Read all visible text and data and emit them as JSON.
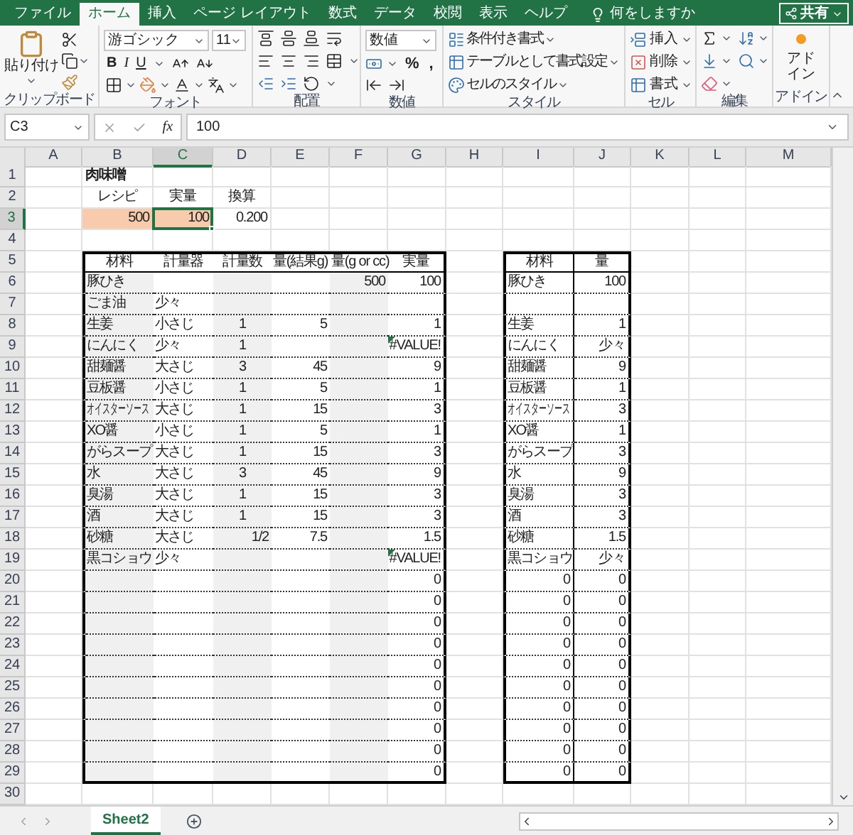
{
  "ribbon_tabs": [
    {
      "label": "ファイル",
      "selected": false
    },
    {
      "label": "ホーム",
      "selected": true
    },
    {
      "label": "挿入",
      "selected": false
    },
    {
      "label": "ページ レイアウト",
      "selected": false
    },
    {
      "label": "数式",
      "selected": false
    },
    {
      "label": "データ",
      "selected": false
    },
    {
      "label": "校閲",
      "selected": false
    },
    {
      "label": "表示",
      "selected": false
    },
    {
      "label": "ヘルプ",
      "selected": false
    }
  ],
  "tell_me": "何をしますか",
  "share": "共有",
  "ribbon_groups": [
    {
      "kind": "clipboard",
      "label": "クリップボード",
      "paste": "貼り付け"
    },
    {
      "kind": "font",
      "label": "フォント",
      "font": "游ゴシック",
      "size": "11",
      "styles": [
        "B",
        "I",
        "U"
      ]
    },
    {
      "kind": "alignment",
      "label": "配置"
    },
    {
      "kind": "number",
      "label": "数値",
      "format": "数値",
      "symbols": [
        "%",
        ","
      ]
    },
    {
      "kind": "styles",
      "label": "スタイル",
      "commands": [
        "条件付き書式",
        "テーブルとして書式設定",
        "セルのスタイル"
      ]
    },
    {
      "kind": "cells",
      "label": "セル",
      "commands": [
        "挿入",
        "削除",
        "書式"
      ]
    },
    {
      "kind": "editing",
      "label": "編集"
    },
    {
      "kind": "addins",
      "label": "アドイン",
      "button": "アドイン"
    }
  ],
  "formula_bar": {
    "name_box": "C3",
    "function_label": "fx",
    "formula": "100"
  },
  "columns": [
    {
      "label": "A",
      "selected": false
    },
    {
      "label": "B",
      "selected": false
    },
    {
      "label": "C",
      "selected": true
    },
    {
      "label": "D",
      "selected": false
    },
    {
      "label": "E",
      "selected": false
    },
    {
      "label": "F",
      "selected": false
    },
    {
      "label": "G",
      "selected": false
    },
    {
      "label": "H",
      "selected": false
    },
    {
      "label": "I",
      "selected": false
    },
    {
      "label": "J",
      "selected": false
    },
    {
      "label": "K",
      "selected": false
    },
    {
      "label": "L",
      "selected": false
    },
    {
      "label": "M",
      "selected": false
    }
  ],
  "rows": [
    {
      "number": "1",
      "selected": false,
      "cells": {
        "B": {
          "text": "肉味噌",
          "kind": "title",
          "selected": false
        }
      }
    },
    {
      "number": "2",
      "selected": false,
      "cells": {
        "B": {
          "text": "レシピ",
          "kind": "center",
          "selected": false
        },
        "C": {
          "text": "実量",
          "kind": "center",
          "selected": false
        },
        "D": {
          "text": "換算",
          "kind": "center",
          "selected": false
        }
      }
    },
    {
      "number": "3",
      "selected": true,
      "cells": {
        "B": {
          "text": "500",
          "kind": "num",
          "selected": false,
          "color": "#f8cbad"
        },
        "C": {
          "text": "100",
          "kind": "num",
          "selected": true,
          "color": "#f8cbad"
        },
        "D": {
          "text": "0.200",
          "kind": "num",
          "selected": false
        }
      }
    },
    {
      "number": "4",
      "selected": false,
      "cells": {}
    },
    {
      "number": "5",
      "selected": false,
      "cells": {
        "B": {
          "text": "材料",
          "kind": "head",
          "selected": false
        },
        "C": {
          "text": "計量器",
          "kind": "head",
          "selected": false
        },
        "D": {
          "text": "計量数",
          "kind": "head",
          "selected": false
        },
        "E": {
          "text": "量(結果g)",
          "kind": "headleft",
          "selected": false
        },
        "F": {
          "text": "量(g or cc)",
          "kind": "headleft",
          "selected": false
        },
        "G": {
          "text": "実量",
          "kind": "head",
          "selected": false
        },
        "I": {
          "text": "材料",
          "kind": "head",
          "selected": false
        },
        "J": {
          "text": "量",
          "kind": "head",
          "selected": false
        }
      }
    },
    {
      "number": "6",
      "selected": false,
      "cells": {
        "B": {
          "text": "豚ひき",
          "kind": "text",
          "selected": false
        },
        "F": {
          "text": "500",
          "kind": "num",
          "selected": false
        },
        "G": {
          "text": "100",
          "kind": "num",
          "selected": false
        },
        "I": {
          "text": "豚ひき",
          "kind": "text",
          "selected": false
        },
        "J": {
          "text": "100",
          "kind": "num",
          "selected": false
        }
      }
    },
    {
      "number": "7",
      "selected": false,
      "cells": {
        "B": {
          "text": "ごま油",
          "kind": "text",
          "selected": false
        },
        "C": {
          "text": "少々",
          "kind": "text",
          "selected": false
        }
      }
    },
    {
      "number": "8",
      "selected": false,
      "cells": {
        "B": {
          "text": "生姜",
          "kind": "text",
          "selected": false
        },
        "C": {
          "text": "小さじ",
          "kind": "text",
          "selected": false
        },
        "D": {
          "text": "1",
          "kind": "center",
          "selected": false
        },
        "E": {
          "text": "5",
          "kind": "num",
          "selected": false
        },
        "G": {
          "text": "1",
          "kind": "num",
          "selected": false
        },
        "I": {
          "text": "生姜",
          "kind": "text",
          "selected": false
        },
        "J": {
          "text": "1",
          "kind": "num",
          "selected": false
        }
      }
    },
    {
      "number": "9",
      "selected": false,
      "cells": {
        "B": {
          "text": "にんにく",
          "kind": "text",
          "selected": false
        },
        "C": {
          "text": "少々",
          "kind": "text",
          "selected": false
        },
        "D": {
          "text": "1",
          "kind": "center",
          "selected": false
        },
        "G": {
          "text": "#VALUE!",
          "kind": "error",
          "selected": false
        },
        "I": {
          "text": "にんにく",
          "kind": "text",
          "selected": false
        },
        "J": {
          "text": "少々",
          "kind": "num",
          "selected": false
        }
      }
    },
    {
      "number": "10",
      "selected": false,
      "cells": {
        "B": {
          "text": "甜麺醤",
          "kind": "text",
          "selected": false
        },
        "C": {
          "text": "大さじ",
          "kind": "text",
          "selected": false
        },
        "D": {
          "text": "3",
          "kind": "center",
          "selected": false
        },
        "E": {
          "text": "45",
          "kind": "num",
          "selected": false
        },
        "G": {
          "text": "9",
          "kind": "num",
          "selected": false
        },
        "I": {
          "text": "甜麺醤",
          "kind": "text",
          "selected": false
        },
        "J": {
          "text": "9",
          "kind": "num",
          "selected": false
        }
      }
    },
    {
      "number": "11",
      "selected": false,
      "cells": {
        "B": {
          "text": "豆板醤",
          "kind": "text",
          "selected": false
        },
        "C": {
          "text": "小さじ",
          "kind": "text",
          "selected": false
        },
        "D": {
          "text": "1",
          "kind": "center",
          "selected": false
        },
        "E": {
          "text": "5",
          "kind": "num",
          "selected": false
        },
        "G": {
          "text": "1",
          "kind": "num",
          "selected": false
        },
        "I": {
          "text": "豆板醤",
          "kind": "text",
          "selected": false
        },
        "J": {
          "text": "1",
          "kind": "num",
          "selected": false
        }
      }
    },
    {
      "number": "12",
      "selected": false,
      "cells": {
        "B": {
          "text": "オイスターソース",
          "kind": "tiny",
          "selected": false
        },
        "C": {
          "text": "大さじ",
          "kind": "text",
          "selected": false
        },
        "D": {
          "text": "1",
          "kind": "center",
          "selected": false
        },
        "E": {
          "text": "15",
          "kind": "num",
          "selected": false
        },
        "G": {
          "text": "3",
          "kind": "num",
          "selected": false
        },
        "I": {
          "text": "オイスターソース",
          "kind": "tiny",
          "selected": false
        },
        "J": {
          "text": "3",
          "kind": "num",
          "selected": false
        }
      }
    },
    {
      "number": "13",
      "selected": false,
      "cells": {
        "B": {
          "text": "XO醤",
          "kind": "text",
          "selected": false
        },
        "C": {
          "text": "小さじ",
          "kind": "text",
          "selected": false
        },
        "D": {
          "text": "1",
          "kind": "center",
          "selected": false
        },
        "E": {
          "text": "5",
          "kind": "num",
          "selected": false
        },
        "G": {
          "text": "1",
          "kind": "num",
          "selected": false
        },
        "I": {
          "text": "XO醤",
          "kind": "text",
          "selected": false
        },
        "J": {
          "text": "1",
          "kind": "num",
          "selected": false
        }
      }
    },
    {
      "number": "14",
      "selected": false,
      "cells": {
        "B": {
          "text": "がらスープ",
          "kind": "text",
          "selected": false
        },
        "C": {
          "text": "大さじ",
          "kind": "text",
          "selected": false
        },
        "D": {
          "text": "1",
          "kind": "center",
          "selected": false
        },
        "E": {
          "text": "15",
          "kind": "num",
          "selected": false
        },
        "G": {
          "text": "3",
          "kind": "num",
          "selected": false
        },
        "I": {
          "text": "がらスープ",
          "kind": "text",
          "selected": false
        },
        "J": {
          "text": "3",
          "kind": "num",
          "selected": false
        }
      }
    },
    {
      "number": "15",
      "selected": false,
      "cells": {
        "B": {
          "text": "水",
          "kind": "text",
          "selected": false
        },
        "C": {
          "text": "大さじ",
          "kind": "text",
          "selected": false
        },
        "D": {
          "text": "3",
          "kind": "center",
          "selected": false
        },
        "E": {
          "text": "45",
          "kind": "num",
          "selected": false
        },
        "G": {
          "text": "9",
          "kind": "num",
          "selected": false
        },
        "I": {
          "text": "水",
          "kind": "text",
          "selected": false
        },
        "J": {
          "text": "9",
          "kind": "num",
          "selected": false
        }
      }
    },
    {
      "number": "16",
      "selected": false,
      "cells": {
        "B": {
          "text": "臭湯",
          "kind": "text",
          "selected": false
        },
        "C": {
          "text": "大さじ",
          "kind": "text",
          "selected": false
        },
        "D": {
          "text": "1",
          "kind": "center",
          "selected": false
        },
        "E": {
          "text": "15",
          "kind": "num",
          "selected": false
        },
        "G": {
          "text": "3",
          "kind": "num",
          "selected": false
        },
        "I": {
          "text": "臭湯",
          "kind": "text",
          "selected": false
        },
        "J": {
          "text": "3",
          "kind": "num",
          "selected": false
        }
      }
    },
    {
      "number": "17",
      "selected": false,
      "cells": {
        "B": {
          "text": "酒",
          "kind": "text",
          "selected": false
        },
        "C": {
          "text": "大さじ",
          "kind": "text",
          "selected": false
        },
        "D": {
          "text": "1",
          "kind": "center",
          "selected": false
        },
        "E": {
          "text": "15",
          "kind": "num",
          "selected": false
        },
        "G": {
          "text": "3",
          "kind": "num",
          "selected": false
        },
        "I": {
          "text": "酒",
          "kind": "text",
          "selected": false
        },
        "J": {
          "text": "3",
          "kind": "num",
          "selected": false
        }
      }
    },
    {
      "number": "18",
      "selected": false,
      "cells": {
        "B": {
          "text": "砂糖",
          "kind": "text",
          "selected": false
        },
        "C": {
          "text": "大さじ",
          "kind": "text",
          "selected": false
        },
        "D": {
          "text": "1/2",
          "kind": "num",
          "selected": false
        },
        "E": {
          "text": "7.5",
          "kind": "num",
          "selected": false
        },
        "G": {
          "text": "1.5",
          "kind": "num",
          "selected": false
        },
        "I": {
          "text": "砂糖",
          "kind": "text",
          "selected": false
        },
        "J": {
          "text": "1.5",
          "kind": "num",
          "selected": false
        }
      }
    },
    {
      "number": "19",
      "selected": false,
      "cells": {
        "B": {
          "text": "黒コショウ",
          "kind": "text",
          "selected": false
        },
        "C": {
          "text": "少々",
          "kind": "text",
          "selected": false
        },
        "G": {
          "text": "#VALUE!",
          "kind": "error",
          "selected": false
        },
        "I": {
          "text": "黒コショウ",
          "kind": "text",
          "selected": false
        },
        "J": {
          "text": "少々",
          "kind": "num",
          "selected": false
        }
      }
    },
    {
      "number": "20",
      "selected": false,
      "cells": {
        "G": {
          "text": "0",
          "kind": "num",
          "selected": false
        },
        "I": {
          "text": "0",
          "kind": "num",
          "selected": false
        },
        "J": {
          "text": "0",
          "kind": "num",
          "selected": false
        }
      }
    },
    {
      "number": "21",
      "selected": false,
      "cells": {
        "G": {
          "text": "0",
          "kind": "num",
          "selected": false
        },
        "I": {
          "text": "0",
          "kind": "num",
          "selected": false
        },
        "J": {
          "text": "0",
          "kind": "num",
          "selected": false
        }
      }
    },
    {
      "number": "22",
      "selected": false,
      "cells": {
        "G": {
          "text": "0",
          "kind": "num",
          "selected": false
        },
        "I": {
          "text": "0",
          "kind": "num",
          "selected": false
        },
        "J": {
          "text": "0",
          "kind": "num",
          "selected": false
        }
      }
    },
    {
      "number": "23",
      "selected": false,
      "cells": {
        "G": {
          "text": "0",
          "kind": "num",
          "selected": false
        },
        "I": {
          "text": "0",
          "kind": "num",
          "selected": false
        },
        "J": {
          "text": "0",
          "kind": "num",
          "selected": false
        }
      }
    },
    {
      "number": "24",
      "selected": false,
      "cells": {
        "G": {
          "text": "0",
          "kind": "num",
          "selected": false
        },
        "I": {
          "text": "0",
          "kind": "num",
          "selected": false
        },
        "J": {
          "text": "0",
          "kind": "num",
          "selected": false
        }
      }
    },
    {
      "number": "25",
      "selected": false,
      "cells": {
        "G": {
          "text": "0",
          "kind": "num",
          "selected": false
        },
        "I": {
          "text": "0",
          "kind": "num",
          "selected": false
        },
        "J": {
          "text": "0",
          "kind": "num",
          "selected": false
        }
      }
    },
    {
      "number": "26",
      "selected": false,
      "cells": {
        "G": {
          "text": "0",
          "kind": "num",
          "selected": false
        },
        "I": {
          "text": "0",
          "kind": "num",
          "selected": false
        },
        "J": {
          "text": "0",
          "kind": "num",
          "selected": false
        }
      }
    },
    {
      "number": "27",
      "selected": false,
      "cells": {
        "G": {
          "text": "0",
          "kind": "num",
          "selected": false
        },
        "I": {
          "text": "0",
          "kind": "num",
          "selected": false
        },
        "J": {
          "text": "0",
          "kind": "num",
          "selected": false
        }
      }
    },
    {
      "number": "28",
      "selected": false,
      "cells": {
        "G": {
          "text": "0",
          "kind": "num",
          "selected": false
        },
        "I": {
          "text": "0",
          "kind": "num",
          "selected": false
        },
        "J": {
          "text": "0",
          "kind": "num",
          "selected": false
        }
      }
    },
    {
      "number": "29",
      "selected": false,
      "cells": {
        "G": {
          "text": "0",
          "kind": "num",
          "selected": false
        },
        "I": {
          "text": "0",
          "kind": "num",
          "selected": false
        },
        "J": {
          "text": "0",
          "kind": "num",
          "selected": false
        }
      }
    },
    {
      "number": "30",
      "selected": false,
      "cells": {}
    }
  ],
  "sheet_tabs": [
    {
      "label": "Sheet2",
      "selected": true
    }
  ]
}
